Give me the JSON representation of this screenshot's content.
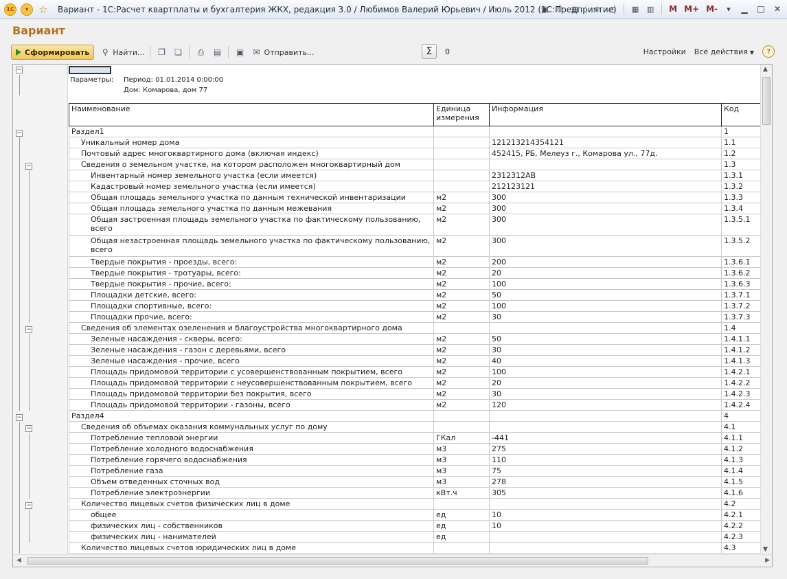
{
  "window": {
    "title": "Вариант - 1С:Расчет квартплаты и бухгалтерия ЖКХ, редакция 3.0 / Любимов Валерий Юрьевич / Июль 2012  (1С:Предприятие)",
    "logo": "1С",
    "toolbar_letters": [
      "M",
      "M+",
      "M-"
    ]
  },
  "form": {
    "title": "Вариант"
  },
  "commands": {
    "generate": "Сформировать",
    "find": "Найти...",
    "send": "Отправить...",
    "sum_value": "0",
    "settings": "Настройки",
    "all_actions": "Все действия",
    "help": "?"
  },
  "report": {
    "params_label": "Параметры:",
    "period": "Период: 01.01.2014 0:00:00",
    "house": "Дом: Комарова, дом 77",
    "columns": {
      "name": "Наименование",
      "unit": "Единица измерения",
      "info": "Информация",
      "code": "Код"
    },
    "rows": [
      {
        "level": 1,
        "name": "Раздел1",
        "unit": "",
        "info": "",
        "code": "1"
      },
      {
        "level": 2,
        "name": "Уникальный номер дома",
        "unit": "",
        "info": "121213214354121",
        "code": "1.1"
      },
      {
        "level": 2,
        "name": "Почтовый адрес многоквартирного дома (включая индекс)",
        "unit": "",
        "info": "452415, РБ, Мелеуз г., Комарова ул., 77д.",
        "code": "1.2"
      },
      {
        "level": 2,
        "name": "Сведения о земельном участке, на котором расположен многоквартирный дом",
        "unit": "",
        "info": "",
        "code": "1.3"
      },
      {
        "level": 3,
        "name": "Инвентарный номер земельного участка (если имеется)",
        "unit": "",
        "info": "2312312АВ",
        "code": "1.3.1"
      },
      {
        "level": 3,
        "name": "Кадастровый номер земельного участка (если имеется)",
        "unit": "",
        "info": "212123121",
        "code": "1.3.2"
      },
      {
        "level": 3,
        "name": "Общая площадь земельного участка по данным технической инвентаризации",
        "unit": "м2",
        "info": "300",
        "code": "1.3.3",
        "num": true
      },
      {
        "level": 3,
        "name": "Общая площадь земельного участка по данным межевания",
        "unit": "м2",
        "info": "300",
        "code": "1.3.4",
        "num": true
      },
      {
        "level": 3,
        "name": "Общая застроенная площадь земельного участка по фактическому пользованию, всего",
        "unit": "м2",
        "info": "300",
        "code": "1.3.5.1",
        "num": true,
        "tall": true
      },
      {
        "level": 3,
        "name": "Общая незастроенная площадь земельного участка по фактическому пользованию, всего",
        "unit": "м2",
        "info": "300",
        "code": "1.3.5.2",
        "num": true,
        "tall": true
      },
      {
        "level": 3,
        "name": "Твердые покрытия - проезды, всего:",
        "unit": "м2",
        "info": "200",
        "code": "1.3.6.1",
        "num": true
      },
      {
        "level": 3,
        "name": "Твердые покрытия - тротуары, всего:",
        "unit": "м2",
        "info": "20",
        "code": "1.3.6.2",
        "num": true
      },
      {
        "level": 3,
        "name": "Твердые покрытия - прочие, всего:",
        "unit": "м2",
        "info": "100",
        "code": "1.3.6.3",
        "num": true
      },
      {
        "level": 3,
        "name": "Площадки детские, всего:",
        "unit": "м2",
        "info": "50",
        "code": "1.3.7.1",
        "num": true
      },
      {
        "level": 3,
        "name": "Площадки спортивные, всего:",
        "unit": "м2",
        "info": "100",
        "code": "1.3.7.2",
        "num": true
      },
      {
        "level": 3,
        "name": "Площадки прочие, всего:",
        "unit": "м2",
        "info": "30",
        "code": "1.3.7.3",
        "num": true
      },
      {
        "level": 2,
        "name": "Сведения об элементах озеленения и благоустройства многоквартирного дома",
        "unit": "",
        "info": "",
        "code": "1.4"
      },
      {
        "level": 3,
        "name": "Зеленые насаждения - скверы, всего:",
        "unit": "м2",
        "info": "50",
        "code": "1.4.1.1",
        "num": true
      },
      {
        "level": 3,
        "name": "Зеленые насаждения - газон с деревьями, всего",
        "unit": "м2",
        "info": "30",
        "code": "1.4.1.2",
        "num": true
      },
      {
        "level": 3,
        "name": "Зеленые насаждения - прочие, всего",
        "unit": "м2",
        "info": "40",
        "code": "1.4.1.3",
        "num": true
      },
      {
        "level": 3,
        "name": "Площадь придомовой территории с усовершенствованным покрытием, всего",
        "unit": "м2",
        "info": "100",
        "code": "1.4.2.1",
        "num": true
      },
      {
        "level": 3,
        "name": "Площадь придомовой территории с неусовершенствованным покрытием, всего",
        "unit": "м2",
        "info": "20",
        "code": "1.4.2.2",
        "num": true
      },
      {
        "level": 3,
        "name": "Площадь придомовой территории без покрытия, всего",
        "unit": "м2",
        "info": "30",
        "code": "1.4.2.3",
        "num": true
      },
      {
        "level": 3,
        "name": "Площадь придомовой территории - газоны, всего",
        "unit": "м2",
        "info": "120",
        "code": "1.4.2.4",
        "num": true
      },
      {
        "level": 1,
        "name": "Раздел4",
        "unit": "",
        "info": "",
        "code": "4"
      },
      {
        "level": 2,
        "name": "Сведения об объемах оказания коммунальных услуг по дому",
        "unit": "",
        "info": "",
        "code": "4.1"
      },
      {
        "level": 3,
        "name": "Потребление тепловой энергии",
        "unit": "ГКал",
        "info": "-441",
        "code": "4.1.1",
        "num": true
      },
      {
        "level": 3,
        "name": "Потребление холодного водоснабжения",
        "unit": "м3",
        "info": "275",
        "code": "4.1.2",
        "num": true
      },
      {
        "level": 3,
        "name": "Потребление горячего водоснабжения",
        "unit": "м3",
        "info": "110",
        "code": "4.1.3",
        "num": true
      },
      {
        "level": 3,
        "name": "Потребление газа",
        "unit": "м3",
        "info": "75",
        "code": "4.1.4",
        "num": true
      },
      {
        "level": 3,
        "name": "Объем отведенных сточных вод",
        "unit": "м3",
        "info": "278",
        "code": "4.1.5",
        "num": true
      },
      {
        "level": 3,
        "name": "Потребление электроэнергии",
        "unit": "кВт.ч",
        "info": "305",
        "code": "4.1.6",
        "num": true
      },
      {
        "level": 2,
        "name": "Количество лицевых счетов физических лиц в доме",
        "unit": "",
        "info": "",
        "code": "4.2"
      },
      {
        "level": 3,
        "name": "общее",
        "unit": "ед",
        "info": "10",
        "code": "4.2.1",
        "num": true
      },
      {
        "level": 3,
        "name": "физических лиц - собственников",
        "unit": "ед",
        "info": "10",
        "code": "4.2.2",
        "num": true
      },
      {
        "level": 3,
        "name": "физических лиц - нанимателей",
        "unit": "ед",
        "info": "",
        "code": "4.2.3"
      },
      {
        "level": 2,
        "name": "Количество лицевых счетов юридических лиц в доме",
        "unit": "",
        "info": "",
        "code": "4.3"
      }
    ]
  }
}
